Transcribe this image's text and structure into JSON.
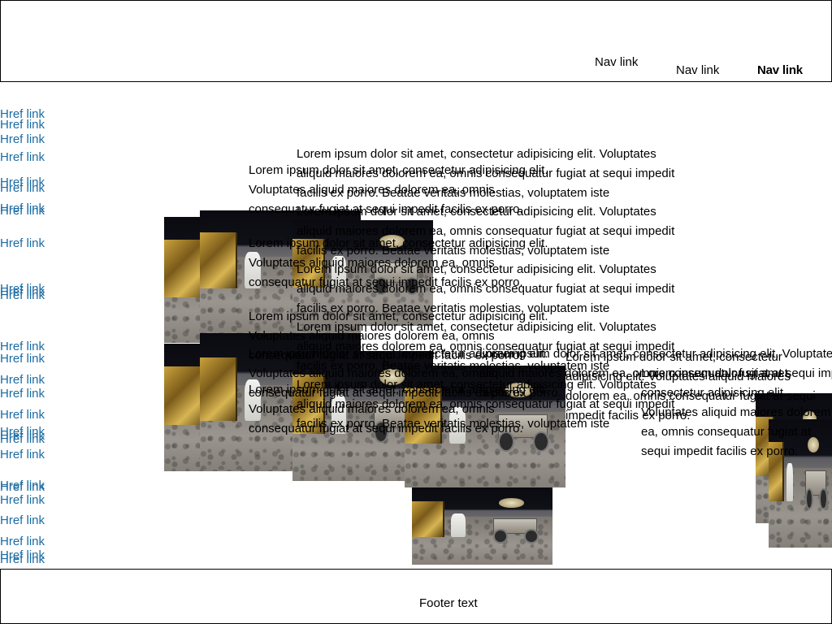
{
  "header": {
    "nav_links": [
      "Nav link",
      "Nav link",
      "Nav link"
    ]
  },
  "sidebar": {
    "links": [
      "Href link",
      "Href link",
      "Href link",
      "Href link",
      "Href link",
      "Href link",
      "Href link",
      "Href link",
      "Href link",
      "Href link",
      "Href link",
      "Href link",
      "Href link",
      "Href link",
      "Href link",
      "Href link",
      "Href link",
      "Href link",
      "Href link",
      "Href link",
      "Href link",
      "Href link",
      "Href link",
      "Href link",
      "Href link",
      "Href link",
      "Href link",
      "Href link"
    ]
  },
  "content": {
    "paragraph_long": "Lorem ipsum dolor sit amet, consectetur adipisicing elit. Voluptates aliquid maiores dolorem ea, omnis consequatur fugiat at sequi impedit facilis ex porro. Beatae veritatis molestias, voluptatem iste",
    "paragraph_short": "Lorem ipsum dolor sit amet, consectetur adipisicing elit. Voluptates aliquid maiores dolorem ea, omnis consequatur fugiat at sequi impedit facilis ex porro.",
    "image_alt": "Lunar rover on the moon surface"
  },
  "footer": {
    "text": "Footer text"
  }
}
